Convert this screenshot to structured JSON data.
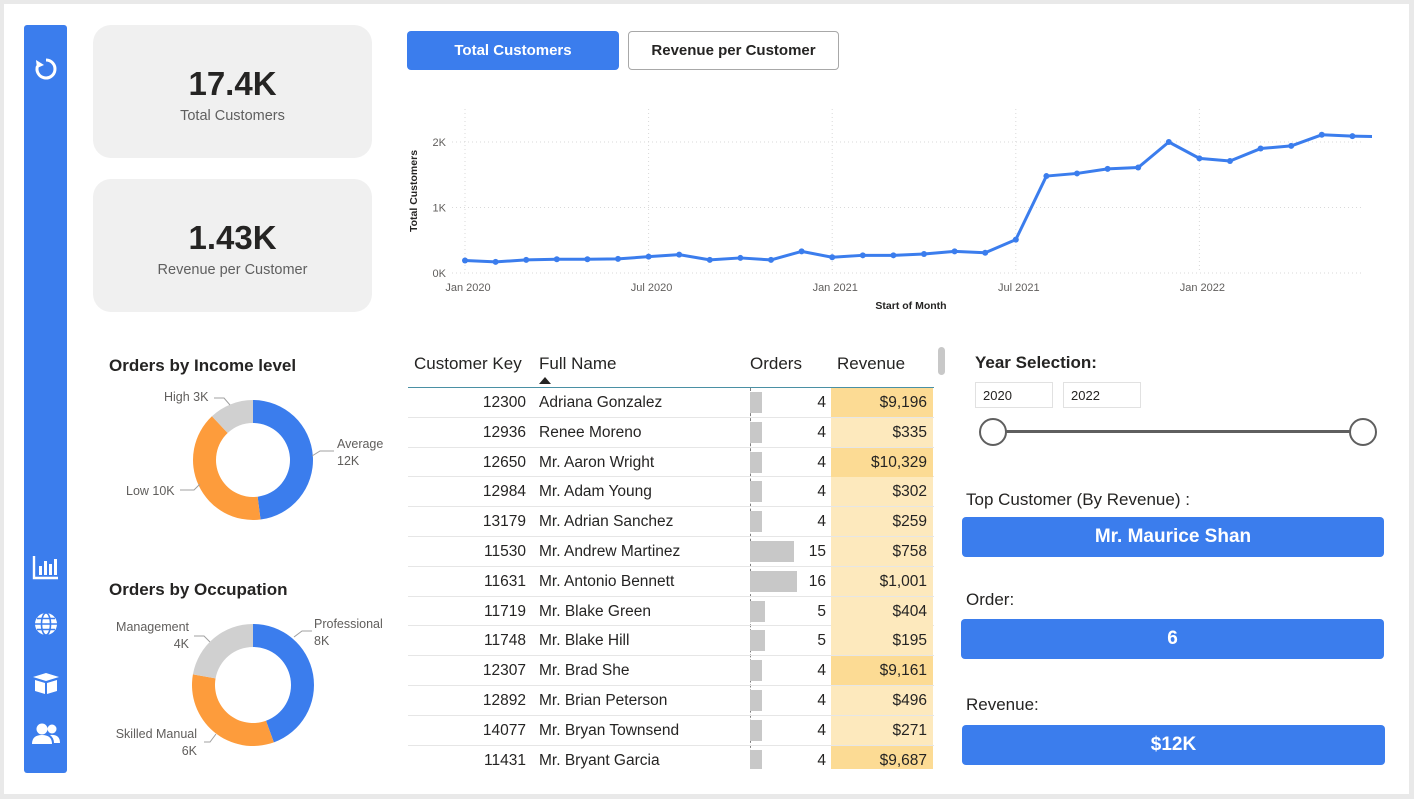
{
  "kpis": {
    "total_customers": {
      "value": "17.4K",
      "label": "Total Customers"
    },
    "revenue_per_customer": {
      "value": "1.43K",
      "label": "Revenue per Customer"
    }
  },
  "tabs": [
    {
      "label": "Total Customers",
      "active": true
    },
    {
      "label": "Revenue per Customer",
      "active": false
    }
  ],
  "sidebar": {
    "icons": [
      "refresh-icon",
      "bar-chart-icon",
      "globe-icon",
      "box-icon",
      "users-icon"
    ]
  },
  "colors": {
    "accent": "#3b7ded",
    "orange": "#fd9c3c",
    "gray": "#d0d0d0",
    "revenue_cell": "#fde9bd",
    "revenue_cell_high": "#fcdb94"
  },
  "chart_data": {
    "type": "line",
    "xlabel": "Start of Month",
    "ylabel": "Total Customers",
    "x_ticks": [
      "Jan 2020",
      "Jul 2020",
      "Jan 2021",
      "Jul 2021",
      "Jan 2022"
    ],
    "y_ticks": [
      "0K",
      "1K",
      "2K"
    ],
    "ylim": [
      0,
      2000
    ],
    "grid": true,
    "x": [
      "2020-01",
      "2020-02",
      "2020-03",
      "2020-04",
      "2020-05",
      "2020-06",
      "2020-07",
      "2020-08",
      "2020-09",
      "2020-10",
      "2020-11",
      "2020-12",
      "2021-01",
      "2021-02",
      "2021-03",
      "2021-04",
      "2021-05",
      "2021-06",
      "2021-07",
      "2021-08",
      "2021-09",
      "2021-10",
      "2021-11",
      "2021-12",
      "2022-01",
      "2022-02",
      "2022-03",
      "2022-04",
      "2022-05",
      "2022-06",
      "2022-07"
    ],
    "series": [
      {
        "values": [
          190,
          170,
          200,
          210,
          210,
          215,
          250,
          280,
          200,
          230,
          200,
          330,
          240,
          270,
          270,
          290,
          330,
          310,
          510,
          1480,
          1520,
          1590,
          1610,
          2000,
          1750,
          1710,
          1900,
          1940,
          2110,
          2090,
          2080
        ]
      }
    ]
  },
  "income_donut": {
    "title": "Orders by Income level",
    "slices": [
      {
        "name": "Average",
        "value": 12,
        "text": "Average\n12K",
        "color": "#3b7ded"
      },
      {
        "name": "Low",
        "value": 10,
        "text": "Low 10K",
        "color": "#fd9c3c"
      },
      {
        "name": "High",
        "value": 3,
        "text": "High 3K",
        "color": "#d0d0d0"
      }
    ]
  },
  "occupation_donut": {
    "title": "Orders by Occupation",
    "slices": [
      {
        "name": "Professional",
        "value": 8,
        "text": "Professional\n8K",
        "color": "#3b7ded"
      },
      {
        "name": "Skilled Manual",
        "value": 6,
        "text": "Skilled Manual\n6K",
        "color": "#fd9c3c"
      },
      {
        "name": "Management",
        "value": 4,
        "text": "Management\n4K",
        "color": "#d0d0d0"
      }
    ]
  },
  "table": {
    "headers": [
      "Customer Key",
      "Full Name",
      "Orders",
      "Revenue"
    ],
    "rows": [
      {
        "key": "12300",
        "name": "Adriana Gonzalez",
        "orders": 4,
        "revenue": "$9,196",
        "high": true
      },
      {
        "key": "12936",
        "name": "Renee Moreno",
        "orders": 4,
        "revenue": "$335",
        "high": false
      },
      {
        "key": "12650",
        "name": "Mr. Aaron Wright",
        "orders": 4,
        "revenue": "$10,329",
        "high": true
      },
      {
        "key": "12984",
        "name": "Mr. Adam Young",
        "orders": 4,
        "revenue": "$302",
        "high": false
      },
      {
        "key": "13179",
        "name": "Mr. Adrian Sanchez",
        "orders": 4,
        "revenue": "$259",
        "high": false
      },
      {
        "key": "11530",
        "name": "Mr. Andrew Martinez",
        "orders": 15,
        "revenue": "$758",
        "high": false
      },
      {
        "key": "11631",
        "name": "Mr. Antonio Bennett",
        "orders": 16,
        "revenue": "$1,001",
        "high": false
      },
      {
        "key": "11719",
        "name": "Mr. Blake Green",
        "orders": 5,
        "revenue": "$404",
        "high": false
      },
      {
        "key": "11748",
        "name": "Mr. Blake Hill",
        "orders": 5,
        "revenue": "$195",
        "high": false
      },
      {
        "key": "12307",
        "name": "Mr. Brad She",
        "orders": 4,
        "revenue": "$9,161",
        "high": true
      },
      {
        "key": "12892",
        "name": "Mr. Brian Peterson",
        "orders": 4,
        "revenue": "$496",
        "high": false
      },
      {
        "key": "14077",
        "name": "Mr. Bryan Townsend",
        "orders": 4,
        "revenue": "$271",
        "high": false
      },
      {
        "key": "11431",
        "name": "Mr. Bryant Garcia",
        "orders": 4,
        "revenue": "$9,687",
        "high": true
      }
    ]
  },
  "year_selection": {
    "label": "Year Selection:",
    "from": "2020",
    "to": "2022"
  },
  "top_customer": {
    "label": "Top Customer (By Revenue) :",
    "name": "Mr. Maurice Shan",
    "order_label": "Order:",
    "order_value": "6",
    "revenue_label": "Revenue:",
    "revenue_value": "$12K"
  }
}
